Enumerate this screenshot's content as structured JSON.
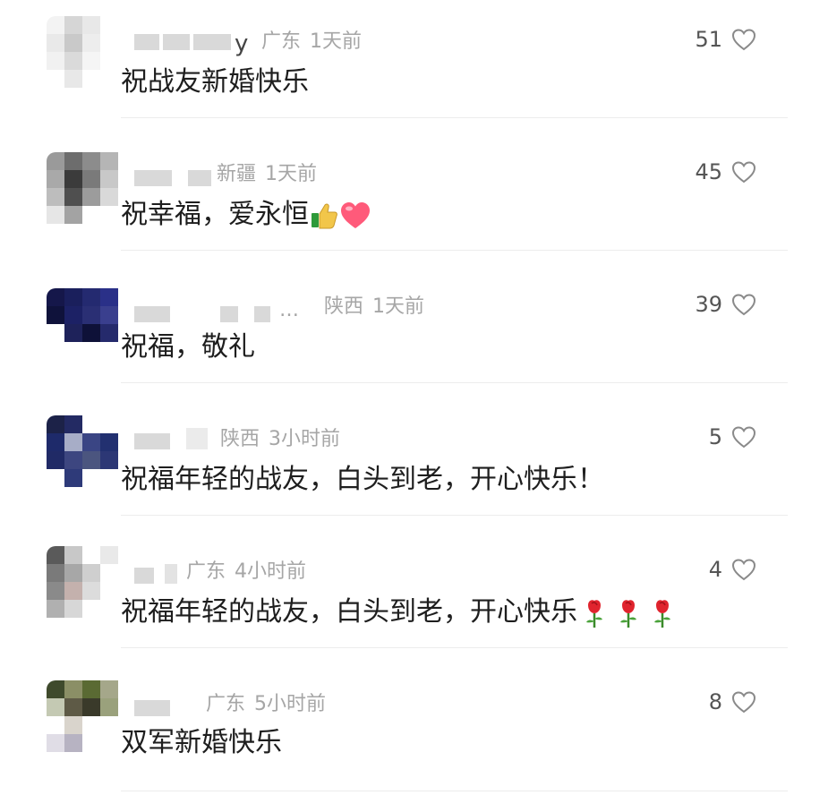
{
  "comments": [
    {
      "location": "广东",
      "time": "1天前",
      "text": "祝战友新婚快乐",
      "likes": "51",
      "name_tail": "y",
      "avatar": [
        "#f3f3f3",
        "#d6d6d6",
        "#e8e8e8",
        "#ffffff",
        "#e9e9e9",
        "#c9c9c9",
        "#ededed",
        "#ffffff",
        "#f1f1f1",
        "#dadada",
        "#f5f5f5",
        "#ffffff",
        "#ffffff",
        "#e8e8e8",
        "#ffffff",
        "#ffffff"
      ]
    },
    {
      "location": "新疆",
      "time": "1天前",
      "text": "祝幸福，爱永恒",
      "likes": "45",
      "name_tail": "",
      "avatar": [
        "#9a9a9a",
        "#6d6d6d",
        "#8c8c8c",
        "#b5b5b5",
        "#a9a9a9",
        "#3b3b3b",
        "#7a7a7a",
        "#c8c8c8",
        "#bdbdbd",
        "#4f4f4f",
        "#9c9c9c",
        "#d9d9d9",
        "#e6e6e6",
        "#a3a3a3",
        "#ffffff",
        "#ffffff"
      ]
    },
    {
      "location": "陕西",
      "time": "1天前",
      "text": "祝福，敬礼",
      "likes": "39",
      "name_tail": "…",
      "avatar": [
        "#15174a",
        "#1a1f5c",
        "#242a70",
        "#2a3088",
        "#0f123b",
        "#1c2165",
        "#2a2f74",
        "#3a3f8e",
        "#ffffff",
        "#1e225a",
        "#0e1138",
        "#252a6c",
        "#ffffff",
        "#ffffff",
        "#ffffff",
        "#ffffff"
      ]
    },
    {
      "location": "陕西",
      "time": "3小时前",
      "text": "祝福年轻的战友，白头到老，开心快乐！",
      "likes": "5",
      "name_tail": "",
      "avatar": [
        "#1c2248",
        "#232a63",
        "#ffffff",
        "#ffffff",
        "#1e2a6a",
        "#a7adc7",
        "#3a4584",
        "#223070",
        "#202a66",
        "#3d4680",
        "#4b557f",
        "#2c3775",
        "#ffffff",
        "#2e3a79",
        "#ffffff",
        "#ffffff"
      ]
    },
    {
      "location": "广东",
      "time": "4小时前",
      "text": "祝福年轻的战友，白头到老，开心快乐",
      "likes": "4",
      "name_tail": "",
      "avatar": [
        "#5a5a5a",
        "#c8c8c8",
        "#ffffff",
        "#e9e9e9",
        "#7a7a7a",
        "#a7a7a7",
        "#cfcfcf",
        "#ffffff",
        "#8a8a8a",
        "#c4b1ad",
        "#dcdcdc",
        "#ffffff",
        "#b0b0b0",
        "#d7d7d7",
        "#ffffff",
        "#ffffff"
      ]
    },
    {
      "location": "广东",
      "time": "5小时前",
      "text": "双军新婚快乐",
      "likes": "8",
      "name_tail": "",
      "avatar": [
        "#3f4a2c",
        "#8b8f66",
        "#5a6a33",
        "#a5a78a",
        "#c4c9b3",
        "#5e5a46",
        "#3a3a2a",
        "#9aa17c",
        "#ffffff",
        "#d9d4cc",
        "#ffffff",
        "#ffffff",
        "#e0dde6",
        "#b7b3c2",
        "#ffffff",
        "#ffffff"
      ]
    }
  ],
  "colors": {
    "meta": "#a6a6a6",
    "text": "#1e1e1e",
    "heart": "#8a8a8a",
    "divider": "#ececec"
  },
  "icons": [
    "heart-outline-icon",
    "thumbs-up-emoji",
    "red-heart-emoji",
    "rose-emoji"
  ]
}
